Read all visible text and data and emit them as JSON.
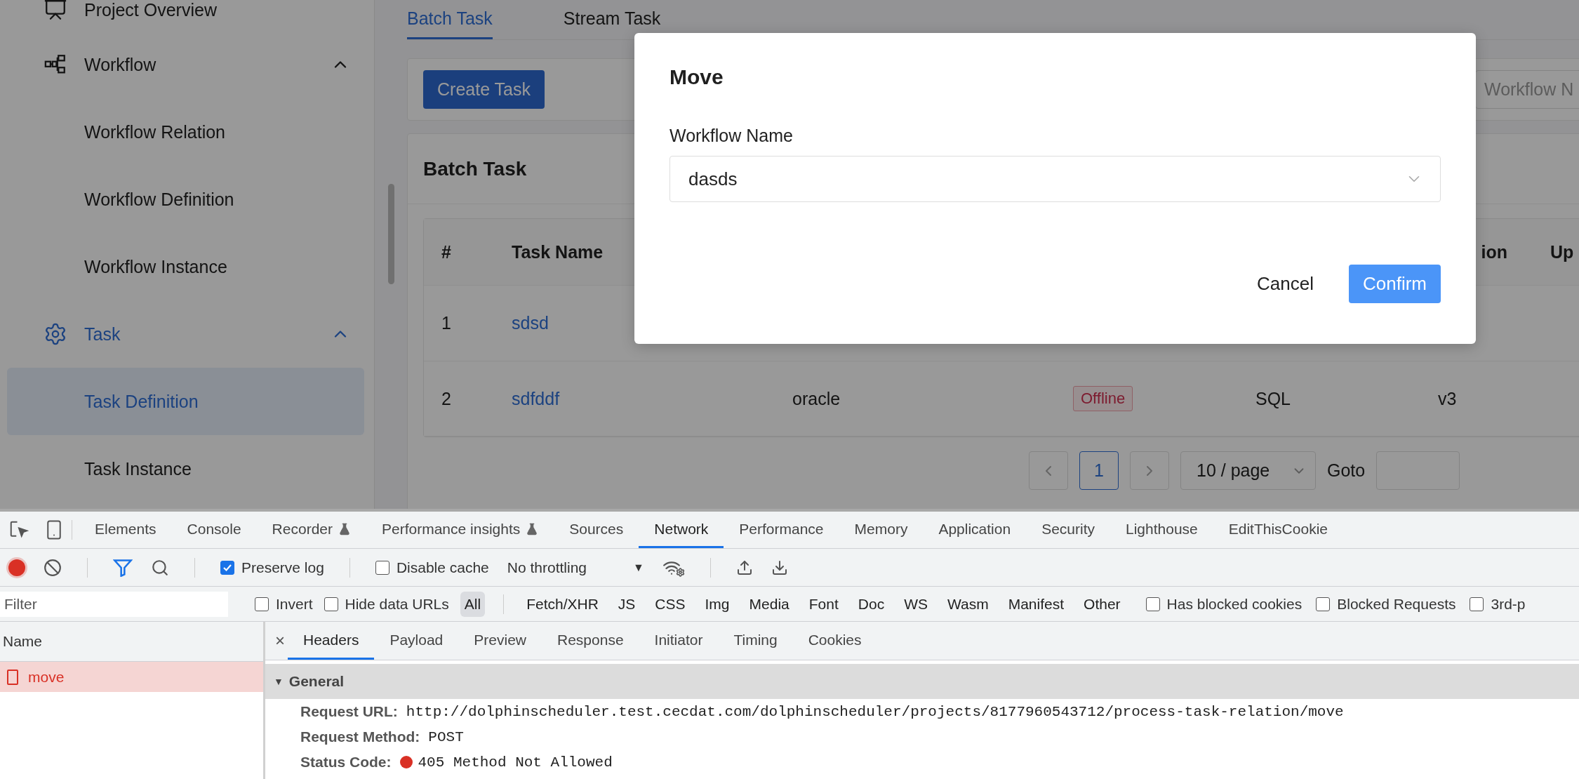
{
  "sidebar": {
    "items": [
      {
        "label": "Project Overview",
        "selected": false
      },
      {
        "label": "Workflow",
        "expanded": true,
        "selected": false,
        "children": [
          {
            "label": "Workflow Relation",
            "selected": false
          },
          {
            "label": "Workflow Definition",
            "selected": false
          },
          {
            "label": "Workflow Instance",
            "selected": false
          }
        ]
      },
      {
        "label": "Task",
        "expanded": true,
        "selected": true,
        "children": [
          {
            "label": "Task Definition",
            "selected": true
          },
          {
            "label": "Task Instance",
            "selected": false
          }
        ]
      }
    ]
  },
  "tabs": [
    {
      "label": "Batch Task",
      "selected": true
    },
    {
      "label": "Stream Task",
      "selected": false
    }
  ],
  "toolbar": {
    "create_button": "Create Task",
    "search": {
      "placeholder": "Workflow N"
    }
  },
  "card": {
    "title": "Batch Task",
    "table": {
      "columns": [
        "#",
        "Task Name",
        "",
        "",
        "",
        "ion",
        "Up"
      ],
      "rows": [
        {
          "cells": [
            "1",
            "sdsd"
          ]
        },
        {
          "cells": [
            "2",
            "sdfddf",
            "oracle",
            "Offline",
            "SQL",
            "v3"
          ]
        }
      ]
    },
    "pagination": {
      "pages": [
        {
          "label": "1",
          "selected": true
        }
      ],
      "page_size": "10 / page",
      "goto_label": "Goto"
    }
  },
  "modal": {
    "title": "Move",
    "field_label": "Workflow Name",
    "field_value": "dasds",
    "buttons": [
      {
        "label": "Cancel",
        "kind": "default"
      },
      {
        "label": "Confirm",
        "kind": "primary"
      }
    ]
  },
  "devtools": {
    "tabs": [
      {
        "label": "Elements",
        "selected": false
      },
      {
        "label": "Console",
        "selected": false
      },
      {
        "label": "Recorder",
        "selected": false,
        "experimental": true
      },
      {
        "label": "Performance insights",
        "selected": false,
        "experimental": true
      },
      {
        "label": "Sources",
        "selected": false
      },
      {
        "label": "Network",
        "selected": true
      },
      {
        "label": "Performance",
        "selected": false
      },
      {
        "label": "Memory",
        "selected": false
      },
      {
        "label": "Application",
        "selected": false
      },
      {
        "label": "Security",
        "selected": false
      },
      {
        "label": "Lighthouse",
        "selected": false
      },
      {
        "label": "EditThisCookie",
        "selected": false
      }
    ],
    "toolbar": {
      "recording": true,
      "preserve_log": {
        "label": "Preserve log",
        "checked": true
      },
      "disable_cache": {
        "label": "Disable cache",
        "checked": false
      },
      "throttling": "No throttling",
      "dropdown_glyph": "▼"
    },
    "filter": {
      "placeholder": "Filter",
      "invert": {
        "label": "Invert",
        "checked": false
      },
      "hide_data_urls": {
        "label": "Hide data URLs",
        "checked": false
      },
      "types": [
        {
          "label": "All",
          "selected": true
        },
        {
          "label": "Fetch/XHR",
          "selected": false
        },
        {
          "label": "JS",
          "selected": false
        },
        {
          "label": "CSS",
          "selected": false
        },
        {
          "label": "Img",
          "selected": false
        },
        {
          "label": "Media",
          "selected": false
        },
        {
          "label": "Font",
          "selected": false
        },
        {
          "label": "Doc",
          "selected": false
        },
        {
          "label": "WS",
          "selected": false
        },
        {
          "label": "Wasm",
          "selected": false
        },
        {
          "label": "Manifest",
          "selected": false
        },
        {
          "label": "Other",
          "selected": false
        }
      ],
      "options": [
        {
          "label": "Has blocked cookies",
          "checked": false
        },
        {
          "label": "Blocked Requests",
          "checked": false
        },
        {
          "label": "3rd-p",
          "checked": false
        }
      ]
    },
    "requests": {
      "header": "Name",
      "rows": [
        {
          "name": "move",
          "failed": true
        }
      ]
    },
    "details": {
      "close_glyph": "×",
      "tabs": [
        {
          "label": "Headers",
          "selected": true
        },
        {
          "label": "Payload",
          "selected": false
        },
        {
          "label": "Preview",
          "selected": false
        },
        {
          "label": "Response",
          "selected": false
        },
        {
          "label": "Initiator",
          "selected": false
        },
        {
          "label": "Timing",
          "selected": false
        },
        {
          "label": "Cookies",
          "selected": false
        }
      ],
      "section": {
        "title": "General",
        "caret": "▼",
        "expanded": true,
        "rows": [
          {
            "kind": "plain",
            "label": "Request URL:",
            "value": "http://dolphinscheduler.test.cecdat.com/dolphinscheduler/projects/8177960543712/process-task-relation/move"
          },
          {
            "kind": "plain",
            "label": "Request Method:",
            "value": "POST"
          },
          {
            "kind": "status",
            "label": "Status Code:",
            "value": "405 Method Not Allowed"
          }
        ]
      }
    }
  }
}
